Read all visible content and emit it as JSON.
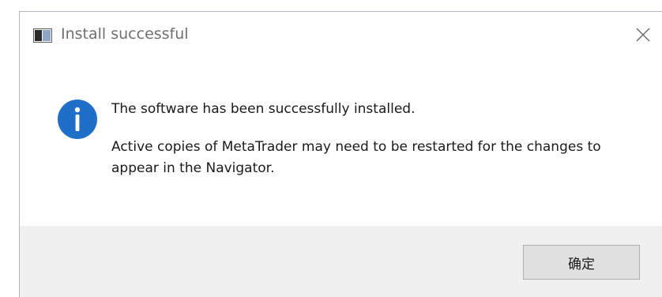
{
  "window": {
    "title": "Install successful",
    "icon": "app-window-icon",
    "close_icon": "close-icon"
  },
  "message": {
    "icon": "info-icon",
    "line1": "The software has been successfully installed.",
    "line2": "Active copies of MetaTrader may need to be restarted for the changes to appear in the Navigator."
  },
  "footer": {
    "ok_label": "确定"
  },
  "colors": {
    "info_blue": "#1f6fc9",
    "footer_bg": "#f0f0f0",
    "button_bg": "#e1e1e1",
    "button_border": "#adadad"
  }
}
